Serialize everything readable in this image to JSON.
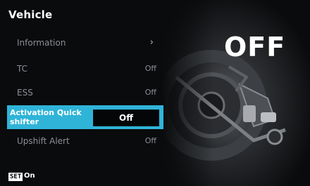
{
  "header": {
    "title": "Vehicle"
  },
  "menu": {
    "items": [
      {
        "label": "Information",
        "value": "",
        "has_chevron": true
      },
      {
        "label": "TC",
        "value": "Off"
      },
      {
        "label": "ESS",
        "value": "Off"
      },
      {
        "label": "Activation Quick shifter",
        "value": "Off",
        "selected": true
      },
      {
        "label": "Upshift Alert",
        "value": "Off"
      }
    ]
  },
  "status": {
    "big_label": "OFF"
  },
  "footer": {
    "key_label": "SET",
    "action_label": "On"
  },
  "icons": {
    "chevron": "chevron-right-icon"
  },
  "colors": {
    "highlight": "#2fb4d8",
    "background": "#0a0b0d",
    "dim_text": "#8b8e93"
  }
}
